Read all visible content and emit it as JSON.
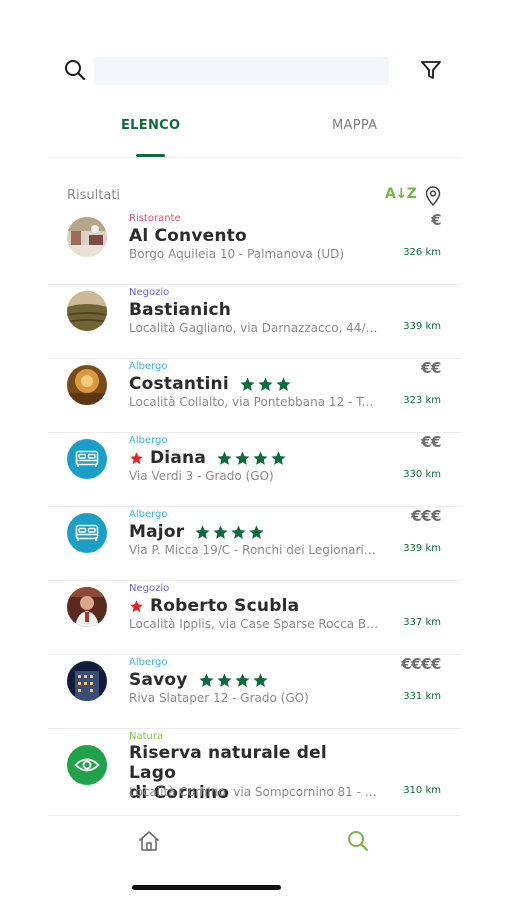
{
  "search": {
    "placeholder": "",
    "value": ""
  },
  "tabs": [
    {
      "label": "ELENCO",
      "active": true
    },
    {
      "label": "MAPPA",
      "active": false
    }
  ],
  "results": {
    "label": "Risultati",
    "sort_label": "A↓Z"
  },
  "items": [
    {
      "category": "Ristorante",
      "category_color": "#e0506c",
      "name": "Al Convento",
      "favorite": false,
      "stars": 0,
      "address": "Borgo Aquileia 10 - Palmanova (UD)",
      "price": "€",
      "distance": "326 km",
      "thumb": "photo-restaurant"
    },
    {
      "category": "Negozio",
      "category_color": "#6b63d9",
      "name": "Bastianich",
      "favorite": false,
      "stars": 0,
      "address": "Località Gagliano, via Darnazzacco, 44/2...",
      "price": "",
      "distance": "339 km",
      "thumb": "photo-vineyard"
    },
    {
      "category": "Albergo",
      "category_color": "#39b6d6",
      "name": "Costantini",
      "favorite": false,
      "stars": 3,
      "address": "Località Collalto, via Pontebbana 12 - Tar...",
      "price": "€€",
      "distance": "323 km",
      "thumb": "photo-hotel-lobby"
    },
    {
      "category": "Albergo",
      "category_color": "#39b6d6",
      "name": "Diana",
      "favorite": true,
      "stars": 4,
      "address": "Via Verdi 3 - Grado (GO)",
      "price": "€€",
      "distance": "330 km",
      "thumb": "bed-icon"
    },
    {
      "category": "Albergo",
      "category_color": "#39b6d6",
      "name": "Major",
      "favorite": false,
      "stars": 4,
      "address": "Via P. Micca 19/C - Ronchi dei Legionari (...",
      "price": "€€€",
      "distance": "339 km",
      "thumb": "bed-icon"
    },
    {
      "category": "Negozio",
      "category_color": "#6b63d9",
      "name": "Roberto Scubla",
      "favorite": true,
      "stars": 0,
      "address": "Località Ipplis, via Case Sparse Rocca Be...",
      "price": "",
      "distance": "337 km",
      "thumb": "photo-person"
    },
    {
      "category": "Albergo",
      "category_color": "#39b6d6",
      "name": "Savoy",
      "favorite": false,
      "stars": 4,
      "address": "Riva Slataper 12 - Grado (GO)",
      "price": "€€€€",
      "distance": "331 km",
      "thumb": "photo-night-building"
    },
    {
      "category": "Natura",
      "category_color": "#8bc34a",
      "name_line1": "Riserva naturale del  Lago",
      "name_line2": "di Cornino",
      "favorite": false,
      "stars": 0,
      "address": "Località Cornino, via Sompcornino 81 - F...",
      "price": "",
      "distance": "310 km",
      "thumb": "eye-icon"
    }
  ],
  "colors": {
    "accent": "#0e6b3f",
    "sort": "#74b843",
    "hotel_icon_bg": "#1a9fc9",
    "nature_icon_bg": "#1fa24a",
    "fav_star": "#e62222",
    "rating_star": "#0e6b3f"
  },
  "bottom_nav": [
    {
      "icon": "home-icon",
      "active": false
    },
    {
      "icon": "search-icon",
      "active": true
    }
  ]
}
